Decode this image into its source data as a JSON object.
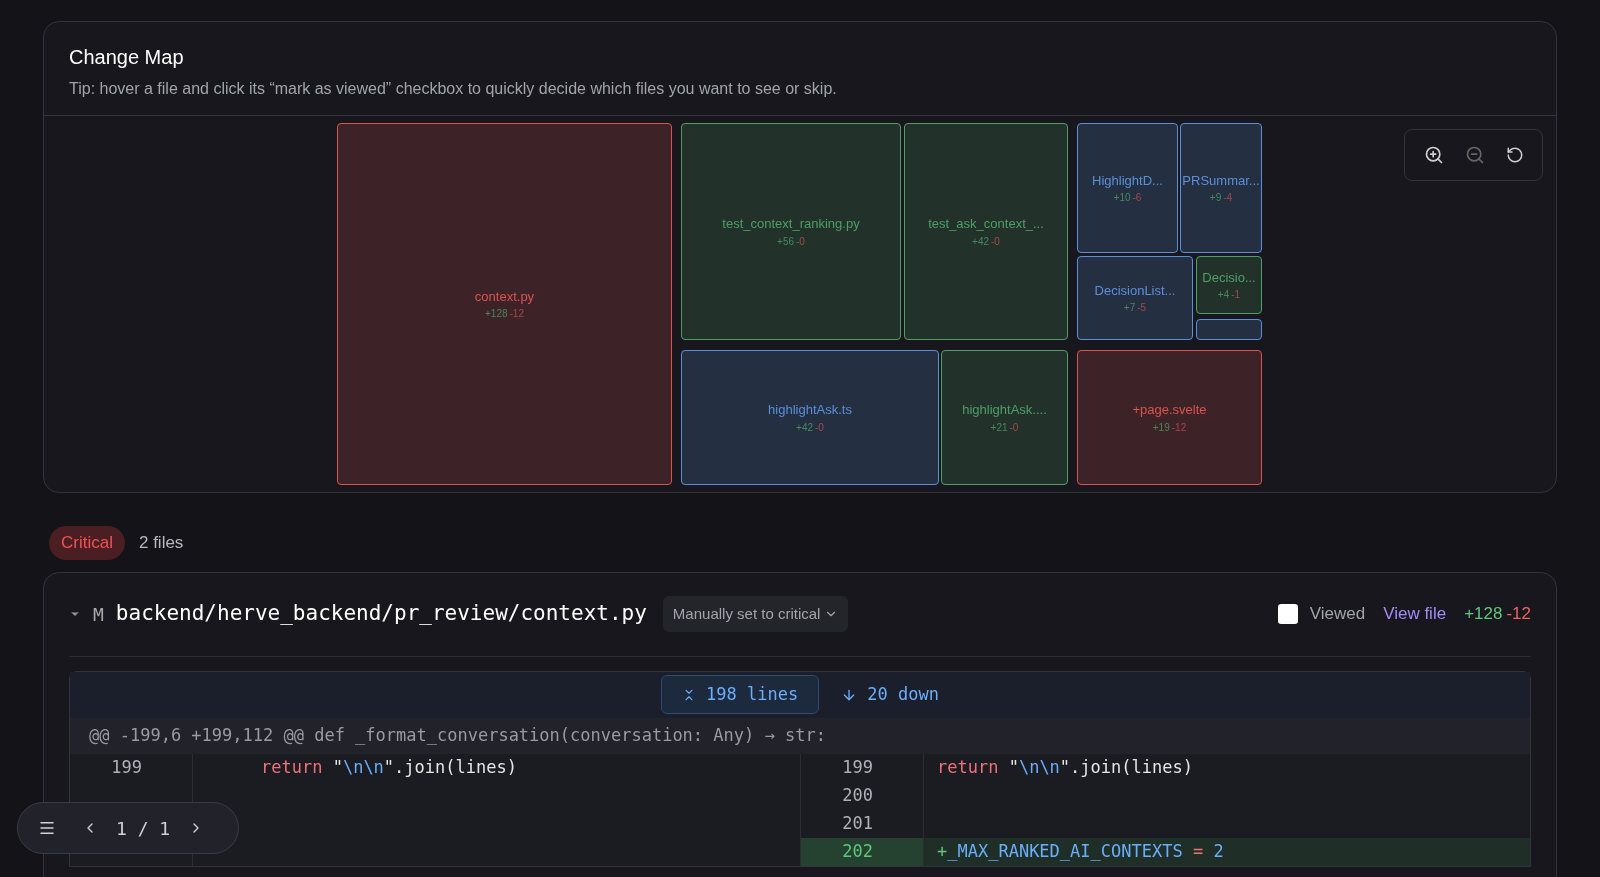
{
  "change_map": {
    "title": "Change Map",
    "tip": "Tip: hover a file and click its “mark as viewed” checkbox to quickly decide which files you want to see or skip.",
    "tiles": [
      {
        "name": "context.py",
        "added": "+128",
        "removed": "-12",
        "color": "#d9534f"
      },
      {
        "name": "test_context_ranking.py",
        "added": "+56",
        "removed": "-0",
        "color": "#4e9e66"
      },
      {
        "name": "test_ask_context_...",
        "added": "+42",
        "removed": "-0",
        "color": "#4e9e66"
      },
      {
        "name": "HighlightD...",
        "added": "+10",
        "removed": "-6",
        "color": "#5b8fd9"
      },
      {
        "name": "PRSummar...",
        "added": "+9",
        "removed": "-4",
        "color": "#5b8fd9"
      },
      {
        "name": "DecisionList...",
        "added": "+7",
        "removed": "-5",
        "color": "#5b8fd9"
      },
      {
        "name": "Decisio...",
        "added": "+4",
        "removed": "-1",
        "color": "#4e9e66"
      },
      {
        "color": "#5b8fd9"
      },
      {
        "name": "highlightAsk.ts",
        "added": "+42",
        "removed": "-0",
        "color": "#5b8fd9"
      },
      {
        "name": "highlightAsk....",
        "added": "+21",
        "removed": "-0",
        "color": "#4e9e66"
      },
      {
        "name": "+page.svelte",
        "added": "+19",
        "removed": "-12",
        "color": "#d9534f"
      }
    ]
  },
  "group": {
    "badge": "Critical",
    "count": "2 files"
  },
  "file": {
    "expanded": true,
    "status": "M",
    "path": "backend/herve_backend/pr_review/context.py",
    "priority": "Manually set to critical",
    "viewed": false,
    "viewed_label": "Viewed",
    "view_link": "View file",
    "added": "+128",
    "removed": "-12",
    "expand_lines": "198 lines",
    "down": "20 down",
    "hunk": "@@ -199,6 +199,112 @@ def _format_conversation(conversation: Any) → str:",
    "rows": [
      {
        "kind": "context",
        "left_no": "199",
        "left_code": [
          {
            "t": "return",
            "kind": "keyword"
          },
          {
            "t": " \"",
            "kind": "plain"
          },
          {
            "t": "\\n\\n",
            "kind": "escape"
          },
          {
            "t": "\".join(lines)",
            "kind": "plain"
          }
        ],
        "right_no": "199",
        "right_code": [
          {
            "t": "return",
            "kind": "keyword"
          },
          {
            "t": " \"",
            "kind": "plain"
          },
          {
            "t": "\\n\\n",
            "kind": "escape"
          },
          {
            "t": "\".join(lines)",
            "kind": "plain"
          }
        ]
      },
      {
        "kind": "context",
        "right_no": "200"
      },
      {
        "kind": "context",
        "right_no": "201"
      },
      {
        "kind": "added",
        "right_no": "202",
        "right_code": [
          {
            "t": "+",
            "kind": "plus"
          },
          {
            "t": "_MAX_RANKED_AI_CONTEXTS",
            "kind": "constant"
          },
          {
            "t": " = ",
            "kind": "keyword"
          },
          {
            "t": "2",
            "kind": "constant"
          }
        ]
      }
    ]
  },
  "pager": {
    "current": "1 / 1"
  }
}
